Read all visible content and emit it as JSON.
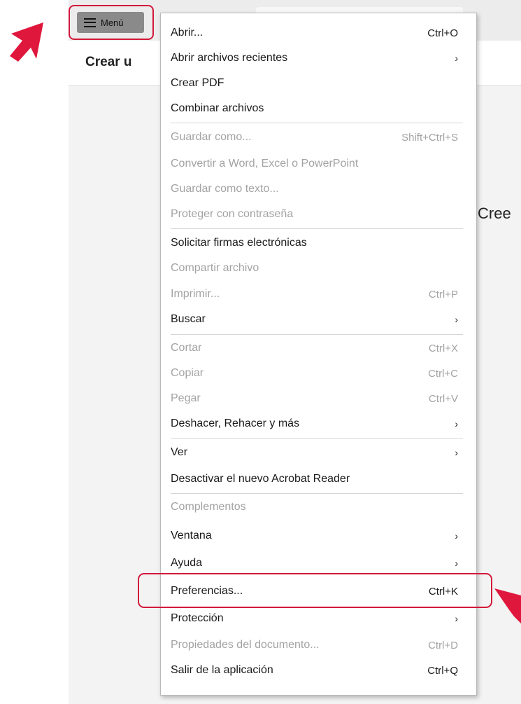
{
  "app": {
    "page_title": "Crear u",
    "side_text": "Cree"
  },
  "menu_button": {
    "label": "Menú",
    "icon": "hamburger-icon"
  },
  "menu": {
    "items": [
      {
        "label": "Abrir...",
        "shortcut": "Ctrl+O",
        "disabled": false,
        "submenu": false
      },
      {
        "label": "Abrir archivos recientes",
        "shortcut": "",
        "disabled": false,
        "submenu": true
      },
      {
        "label": "Crear PDF",
        "shortcut": "",
        "disabled": false,
        "submenu": false
      },
      {
        "label": "Combinar archivos",
        "shortcut": "",
        "disabled": false,
        "submenu": false
      },
      {
        "label": "Guardar como...",
        "shortcut": "Shift+Ctrl+S",
        "disabled": true,
        "submenu": false
      },
      {
        "label": "Convertir a Word, Excel o PowerPoint",
        "shortcut": "",
        "disabled": true,
        "submenu": false
      },
      {
        "label": "Guardar como texto...",
        "shortcut": "",
        "disabled": true,
        "submenu": false
      },
      {
        "label": "Proteger con contraseña",
        "shortcut": "",
        "disabled": true,
        "submenu": false
      },
      {
        "label": "Solicitar firmas electrónicas",
        "shortcut": "",
        "disabled": false,
        "submenu": false
      },
      {
        "label": "Compartir archivo",
        "shortcut": "",
        "disabled": true,
        "submenu": false
      },
      {
        "label": "Imprimir...",
        "shortcut": "Ctrl+P",
        "disabled": true,
        "submenu": false
      },
      {
        "label": "Buscar",
        "shortcut": "",
        "disabled": false,
        "submenu": true
      },
      {
        "label": "Cortar",
        "shortcut": "Ctrl+X",
        "disabled": true,
        "submenu": false
      },
      {
        "label": "Copiar",
        "shortcut": "Ctrl+C",
        "disabled": true,
        "submenu": false
      },
      {
        "label": "Pegar",
        "shortcut": "Ctrl+V",
        "disabled": true,
        "submenu": false
      },
      {
        "label": "Deshacer, Rehacer y más",
        "shortcut": "",
        "disabled": false,
        "submenu": true
      },
      {
        "label": "Ver",
        "shortcut": "",
        "disabled": false,
        "submenu": true
      },
      {
        "label": "Desactivar el nuevo Acrobat Reader",
        "shortcut": "",
        "disabled": false,
        "submenu": false
      },
      {
        "label": "Complementos",
        "shortcut": "",
        "disabled": true,
        "submenu": false
      },
      {
        "label": "Ventana",
        "shortcut": "",
        "disabled": false,
        "submenu": true
      },
      {
        "label": "Ayuda",
        "shortcut": "",
        "disabled": false,
        "submenu": true
      },
      {
        "label": "Preferencias...",
        "shortcut": "Ctrl+K",
        "disabled": false,
        "submenu": false
      },
      {
        "label": "Protección",
        "shortcut": "",
        "disabled": false,
        "submenu": true
      },
      {
        "label": "Propiedades del documento...",
        "shortcut": "Ctrl+D",
        "disabled": true,
        "submenu": false
      },
      {
        "label": "Salir de la aplicación",
        "shortcut": "Ctrl+Q",
        "disabled": false,
        "submenu": false
      }
    ],
    "submenu_glyph": "›"
  },
  "colors": {
    "highlight_outline": "#d2193a",
    "arrow": "#e0173d",
    "disabled_text": "#a3a3a3"
  }
}
